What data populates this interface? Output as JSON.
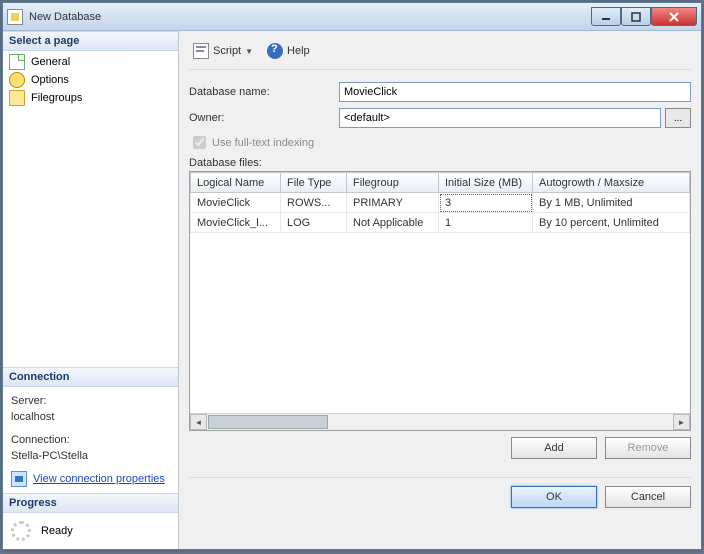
{
  "window": {
    "title": "New Database"
  },
  "sidebar": {
    "select_page_header": "Select a page",
    "pages": [
      {
        "label": "General"
      },
      {
        "label": "Options"
      },
      {
        "label": "Filegroups"
      }
    ],
    "connection_header": "Connection",
    "server_label": "Server:",
    "server_value": "localhost",
    "connection_label": "Connection:",
    "connection_value": "Stella-PC\\Stella",
    "view_conn_props": "View connection properties",
    "progress_header": "Progress",
    "progress_status": "Ready"
  },
  "toolbar": {
    "script_label": "Script",
    "help_label": "Help"
  },
  "form": {
    "db_name_label": "Database name:",
    "db_name_value": "MovieClick",
    "owner_label": "Owner:",
    "owner_value": "<default>",
    "fulltext_label": "Use full-text indexing",
    "db_files_label": "Database files:"
  },
  "grid": {
    "cols": [
      "Logical Name",
      "File Type",
      "Filegroup",
      "Initial Size (MB)",
      "Autogrowth / Maxsize"
    ],
    "rows": [
      {
        "logical": "MovieClick",
        "ftype": "ROWS...",
        "fgroup": "PRIMARY",
        "isize": "3",
        "auto": "By 1 MB, Unlimited"
      },
      {
        "logical": "MovieClick_l...",
        "ftype": "LOG",
        "fgroup": "Not Applicable",
        "isize": "1",
        "auto": "By 10 percent, Unlimited"
      }
    ]
  },
  "buttons": {
    "add": "Add",
    "remove": "Remove",
    "ok": "OK",
    "cancel": "Cancel"
  }
}
